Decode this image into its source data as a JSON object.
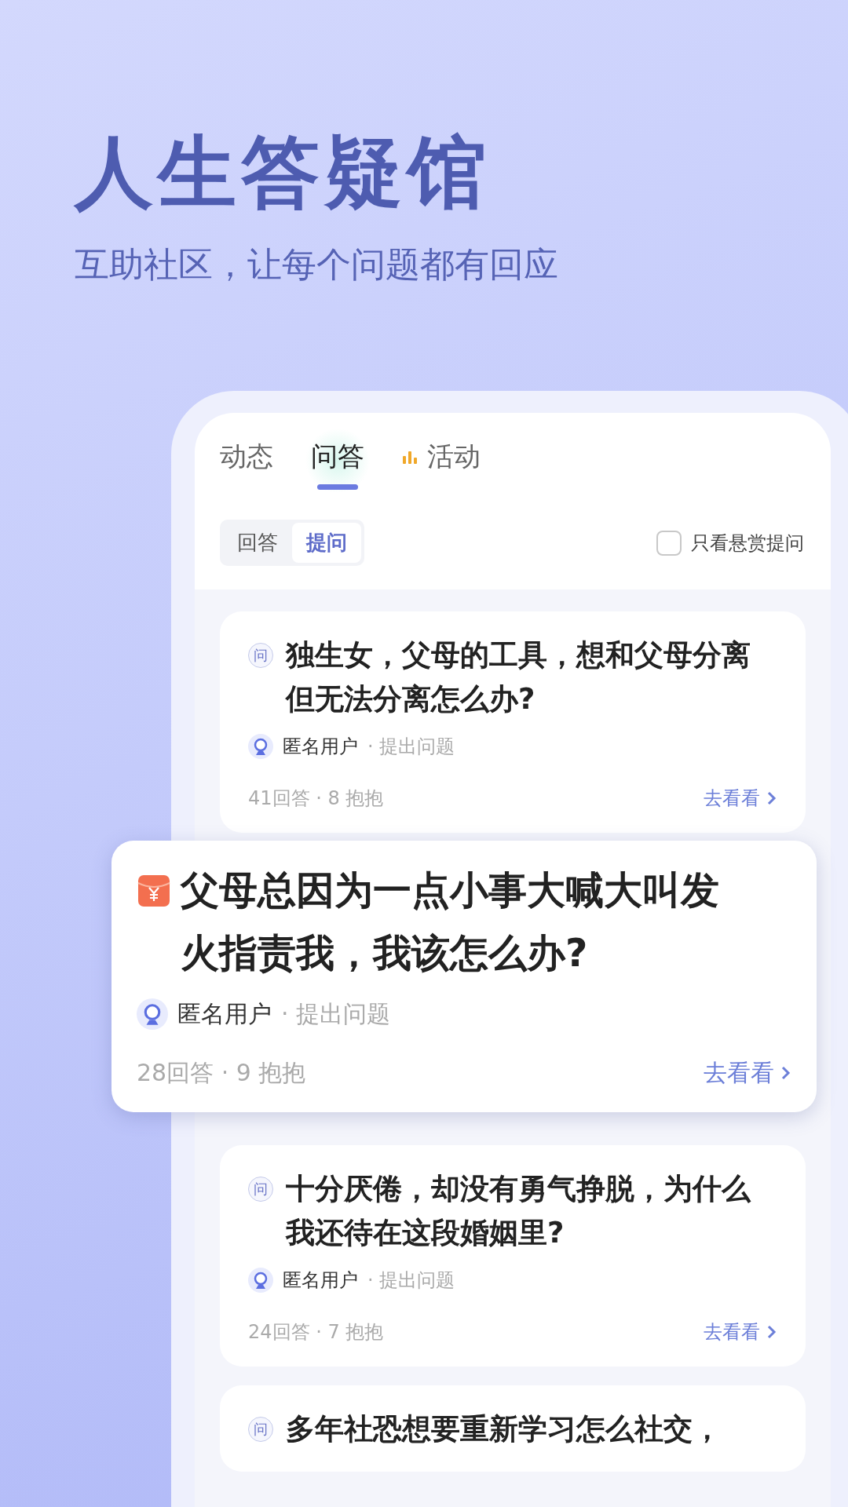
{
  "headline": "人生答疑馆",
  "subtitle": "互助社区，让每个问题都有回应",
  "tabs": [
    {
      "label": "动态",
      "selected": false,
      "kind": "plain"
    },
    {
      "label": "问答",
      "selected": true,
      "kind": "plain"
    },
    {
      "label": "活动",
      "selected": false,
      "kind": "hot"
    }
  ],
  "segments": [
    {
      "label": "回答",
      "selected": false
    },
    {
      "label": "提问",
      "selected": true
    }
  ],
  "filter": {
    "label": "只看悬赏提问",
    "checked": false
  },
  "cards": [
    {
      "kind": "question",
      "featured": false,
      "badge": "问",
      "title": "独生女，父母的工具，想和父母分离但无法分离怎么办?",
      "author": "匿名用户",
      "note": "· 提出问题",
      "stats": "41回答 · 8 抱抱",
      "link": "去看看"
    },
    {
      "kind": "reward",
      "featured": true,
      "title": "父母总因为一点小事大喊大叫发火指责我，我该怎么办?",
      "author": "匿名用户",
      "note": "· 提出问题",
      "stats": "28回答 · 9 抱抱",
      "link": "去看看"
    },
    {
      "kind": "question",
      "featured": false,
      "badge": "问",
      "title": "十分厌倦，却没有勇气挣脱，为什么我还待在这段婚姻里?",
      "author": "匿名用户",
      "note": "· 提出问题",
      "stats": "24回答 · 7 抱抱",
      "link": "去看看"
    },
    {
      "kind": "question",
      "featured": false,
      "badge": "问",
      "title": "多年社恐想要重新学习怎么社交，"
    }
  ]
}
